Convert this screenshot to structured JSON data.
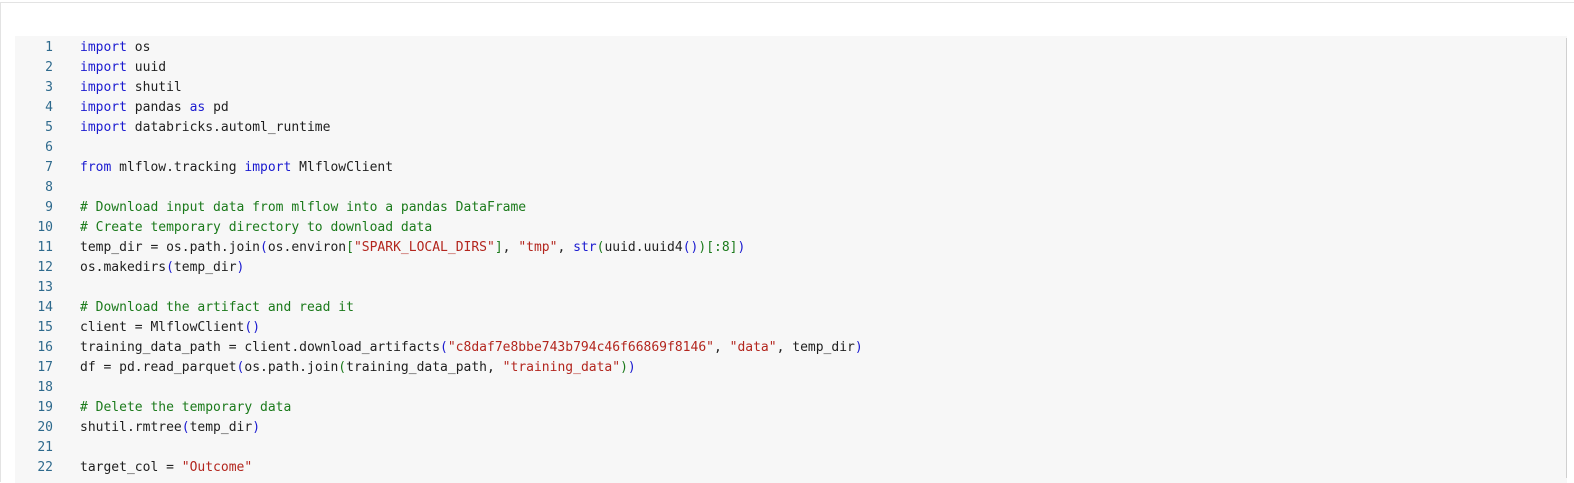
{
  "editor": {
    "lines": [
      {
        "num": "1",
        "tokens": [
          {
            "t": "kw",
            "v": "import"
          },
          {
            "t": "tx",
            "v": " os"
          }
        ]
      },
      {
        "num": "2",
        "tokens": [
          {
            "t": "kw",
            "v": "import"
          },
          {
            "t": "tx",
            "v": " uuid"
          }
        ]
      },
      {
        "num": "3",
        "tokens": [
          {
            "t": "kw",
            "v": "import"
          },
          {
            "t": "tx",
            "v": " shutil"
          }
        ]
      },
      {
        "num": "4",
        "tokens": [
          {
            "t": "kw",
            "v": "import"
          },
          {
            "t": "tx",
            "v": " pandas "
          },
          {
            "t": "kw",
            "v": "as"
          },
          {
            "t": "tx",
            "v": " pd"
          }
        ]
      },
      {
        "num": "5",
        "tokens": [
          {
            "t": "kw",
            "v": "import"
          },
          {
            "t": "tx",
            "v": " databricks.automl_runtime"
          }
        ]
      },
      {
        "num": "6",
        "tokens": []
      },
      {
        "num": "7",
        "tokens": [
          {
            "t": "kw",
            "v": "from"
          },
          {
            "t": "tx",
            "v": " mlflow.tracking "
          },
          {
            "t": "kw",
            "v": "import"
          },
          {
            "t": "tx",
            "v": " MlflowClient"
          }
        ]
      },
      {
        "num": "8",
        "tokens": []
      },
      {
        "num": "9",
        "tokens": [
          {
            "t": "cm",
            "v": "# Download input data from mlflow into a pandas DataFrame"
          }
        ]
      },
      {
        "num": "10",
        "tokens": [
          {
            "t": "cm",
            "v": "# Create temporary directory to download data"
          }
        ]
      },
      {
        "num": "11",
        "tokens": [
          {
            "t": "tx",
            "v": "temp_dir = os.path.join"
          },
          {
            "t": "p1",
            "v": "("
          },
          {
            "t": "tx",
            "v": "os.environ"
          },
          {
            "t": "p2",
            "v": "["
          },
          {
            "t": "st",
            "v": "\"SPARK_LOCAL_DIRS\""
          },
          {
            "t": "p2",
            "v": "]"
          },
          {
            "t": "tx",
            "v": ", "
          },
          {
            "t": "st",
            "v": "\"tmp\""
          },
          {
            "t": "tx",
            "v": ", "
          },
          {
            "t": "bi",
            "v": "str"
          },
          {
            "t": "p2",
            "v": "("
          },
          {
            "t": "tx",
            "v": "uuid.uuid4"
          },
          {
            "t": "p1",
            "v": "()"
          },
          {
            "t": "p2",
            "v": ")"
          },
          {
            "t": "p2",
            "v": "[:8]"
          },
          {
            "t": "p1",
            "v": ")"
          }
        ]
      },
      {
        "num": "12",
        "tokens": [
          {
            "t": "tx",
            "v": "os.makedirs"
          },
          {
            "t": "p1",
            "v": "("
          },
          {
            "t": "tx",
            "v": "temp_dir"
          },
          {
            "t": "p1",
            "v": ")"
          }
        ]
      },
      {
        "num": "13",
        "tokens": []
      },
      {
        "num": "14",
        "tokens": [
          {
            "t": "cm",
            "v": "# Download the artifact and read it"
          }
        ]
      },
      {
        "num": "15",
        "tokens": [
          {
            "t": "tx",
            "v": "client = MlflowClient"
          },
          {
            "t": "p1",
            "v": "()"
          }
        ]
      },
      {
        "num": "16",
        "tokens": [
          {
            "t": "tx",
            "v": "training_data_path = client.download_artifacts"
          },
          {
            "t": "p1",
            "v": "("
          },
          {
            "t": "st",
            "v": "\"c8daf7e8bbe743b794c46f66869f8146\""
          },
          {
            "t": "tx",
            "v": ", "
          },
          {
            "t": "st",
            "v": "\"data\""
          },
          {
            "t": "tx",
            "v": ", temp_dir"
          },
          {
            "t": "p1",
            "v": ")"
          }
        ]
      },
      {
        "num": "17",
        "tokens": [
          {
            "t": "tx",
            "v": "df = pd.read_parquet"
          },
          {
            "t": "p1",
            "v": "("
          },
          {
            "t": "tx",
            "v": "os.path.join"
          },
          {
            "t": "p2",
            "v": "("
          },
          {
            "t": "tx",
            "v": "training_data_path, "
          },
          {
            "t": "st",
            "v": "\"training_data\""
          },
          {
            "t": "p2",
            "v": ")"
          },
          {
            "t": "p1",
            "v": ")"
          }
        ]
      },
      {
        "num": "18",
        "tokens": []
      },
      {
        "num": "19",
        "tokens": [
          {
            "t": "cm",
            "v": "# Delete the temporary data"
          }
        ]
      },
      {
        "num": "20",
        "tokens": [
          {
            "t": "tx",
            "v": "shutil.rmtree"
          },
          {
            "t": "p1",
            "v": "("
          },
          {
            "t": "tx",
            "v": "temp_dir"
          },
          {
            "t": "p1",
            "v": ")"
          }
        ]
      },
      {
        "num": "21",
        "tokens": []
      },
      {
        "num": "22",
        "tokens": [
          {
            "t": "tx",
            "v": "target_col = "
          },
          {
            "t": "st",
            "v": "\"Outcome\""
          }
        ]
      }
    ]
  }
}
